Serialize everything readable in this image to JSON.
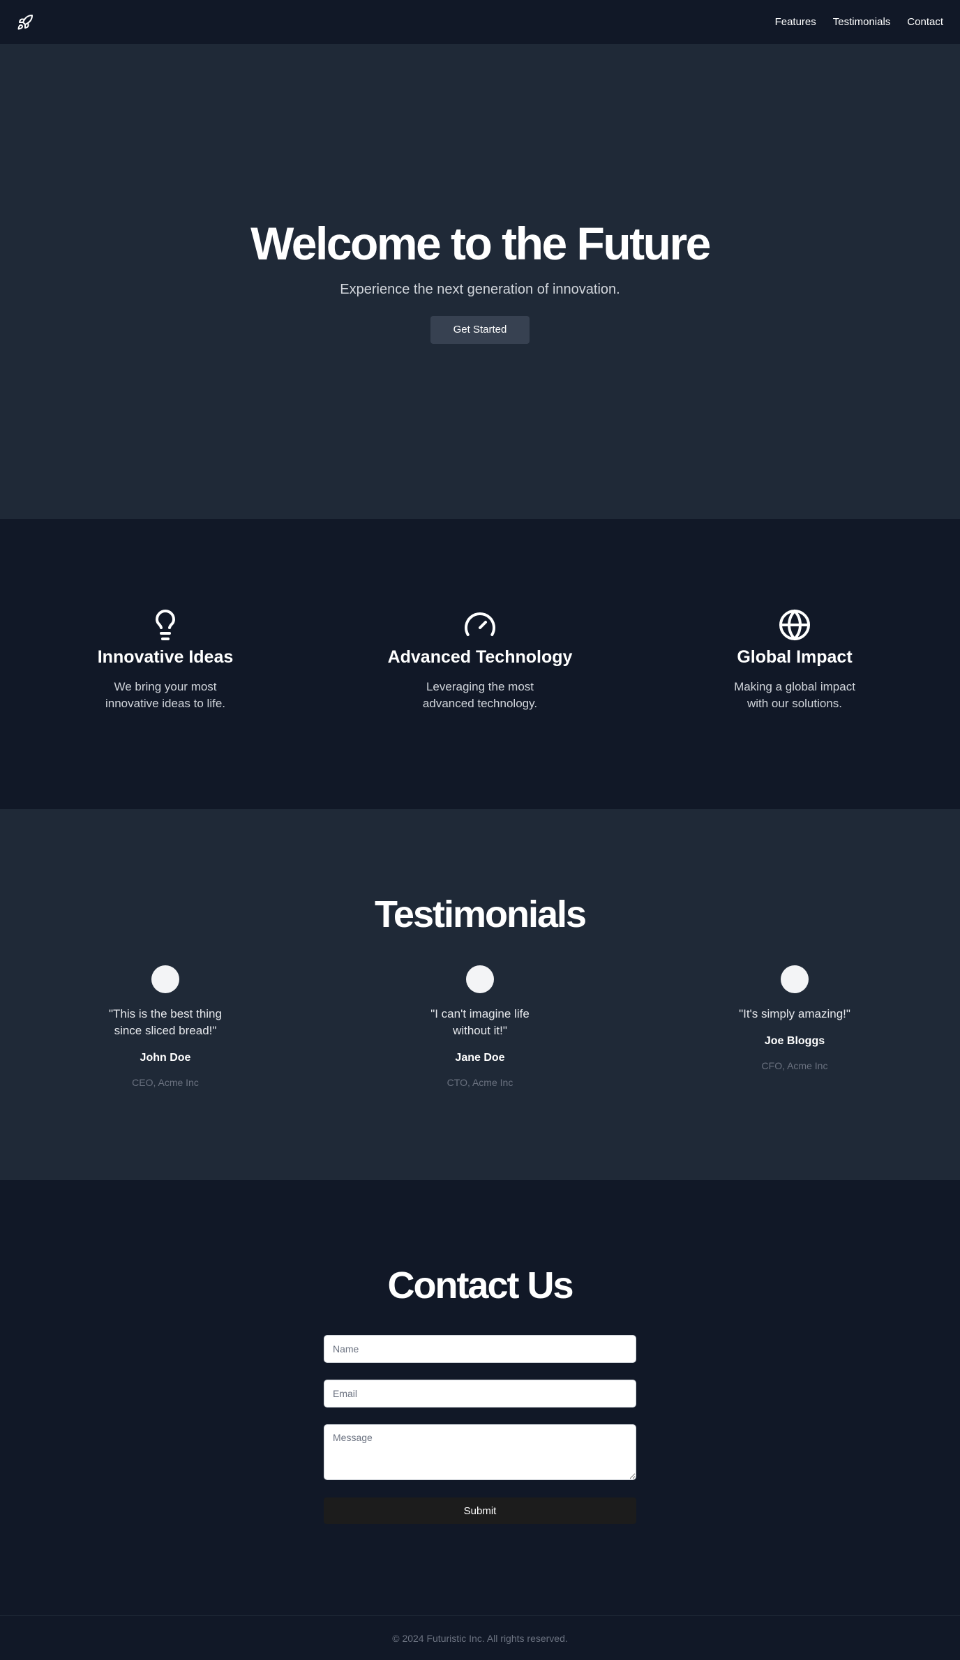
{
  "nav": {
    "logo_icon": "rocket-icon",
    "links": [
      "Features",
      "Testimonials",
      "Contact"
    ]
  },
  "hero": {
    "title": "Welcome to the Future",
    "subtitle": "Experience the next generation of innovation.",
    "cta": "Get Started"
  },
  "features": [
    {
      "icon": "lightbulb-icon",
      "title": "Innovative Ideas",
      "text": "We bring your most innovative ideas to life."
    },
    {
      "icon": "gauge-icon",
      "title": "Advanced Technology",
      "text": "Leveraging the most advanced technology."
    },
    {
      "icon": "globe-icon",
      "title": "Global Impact",
      "text": "Making a global impact with our solutions."
    }
  ],
  "testimonials": {
    "heading": "Testimonials",
    "items": [
      {
        "quote": "\"This is the best thing since sliced bread!\"",
        "name": "John Doe",
        "role": "CEO, Acme Inc"
      },
      {
        "quote": "\"I can't imagine life without it!\"",
        "name": "Jane Doe",
        "role": "CTO, Acme Inc"
      },
      {
        "quote": "\"It's simply amazing!\"",
        "name": "Joe Bloggs",
        "role": "CFO, Acme Inc"
      }
    ]
  },
  "contact": {
    "heading": "Contact Us",
    "name_placeholder": "Name",
    "email_placeholder": "Email",
    "message_placeholder": "Message",
    "submit": "Submit"
  },
  "footer": {
    "copyright": "© 2024 Futuristic Inc. All rights reserved."
  },
  "colors": {
    "nav_bg": "#111827",
    "hero_bg": "#1f2937",
    "button_bg": "#374151",
    "submit_bg": "#1c1c1c"
  }
}
